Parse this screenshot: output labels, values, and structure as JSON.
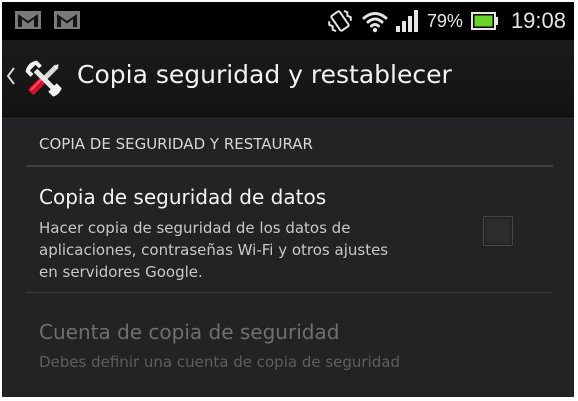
{
  "status_bar": {
    "notifications": [
      "gmail-icon",
      "gmail-icon"
    ],
    "icons": [
      "vibrate-icon",
      "wifi-icon",
      "signal-icon",
      "battery-icon"
    ],
    "battery_percent": "79%",
    "time": "19:08",
    "battery_color": "#6ad32a"
  },
  "action_bar": {
    "title": "Copia seguridad y restablecer",
    "icon": "tools-icon",
    "accent_color": "#d0112b"
  },
  "section": {
    "header": "COPIA DE SEGURIDAD Y RESTAURAR",
    "items": [
      {
        "title": "Copia de seguridad de datos",
        "summary_lines": [
          "Hacer copia de seguridad de los datos de",
          "aplicaciones, contraseñas Wi-Fi y otros ajustes",
          "en servidores Google."
        ],
        "checked": false,
        "enabled": true
      },
      {
        "title": "Cuenta de copia de seguridad",
        "summary_lines": [
          "Debes definir una cuenta de copia de seguridad"
        ],
        "enabled": false
      }
    ]
  }
}
